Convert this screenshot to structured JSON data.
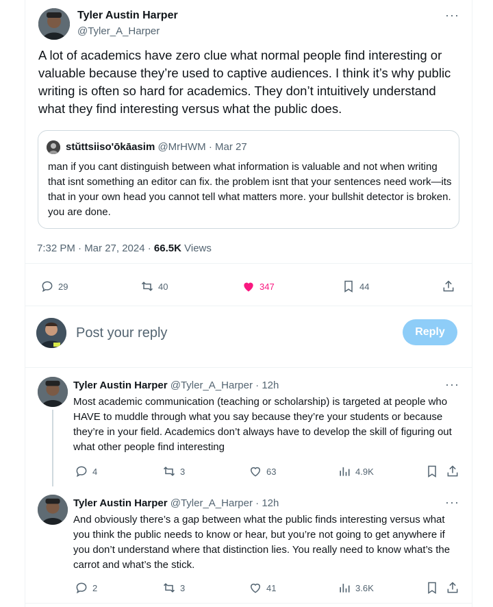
{
  "main_tweet": {
    "author_name": "Tyler Austin Harper",
    "author_handle": "@Tyler_A_Harper",
    "text": "A lot of academics have zero clue what normal people find interesting or valuable because they’re used to captive audiences. I think it’s why public writing is often so hard for academics. They don’t intuitively understand what they find interesting versus what the public does.",
    "quoted": {
      "author_name": "stŭttsiiso'ōkāasim",
      "author_handle": "@MrHWM",
      "date": "· Mar 27",
      "text": "man if you cant distinguish between what information is valuable and not when writing that isnt something an editor can fix. the problem isnt that your sentences need work—its that in your own head you cannot tell what matters more. your bullshit detector is broken. you are done."
    },
    "timestamp": "7:32 PM · Mar 27, 2024 ·",
    "views_count": "66.5K",
    "views_label": "Views",
    "stats": {
      "replies": "29",
      "retweets": "40",
      "likes": "347",
      "bookmarks": "44"
    }
  },
  "reply_box": {
    "placeholder": "Post your reply",
    "button_label": "Reply"
  },
  "replies": [
    {
      "author_name": "Tyler Austin Harper",
      "author_handle": "@Tyler_A_Harper",
      "time": "· 12h",
      "text": "Most academic communication (teaching or scholarship) is targeted at people who HAVE to muddle through what you say because they’re your students or because they’re in your field.  Academics don’t always have to develop the skill of figuring out what other people find interesting",
      "replies": "4",
      "retweets": "3",
      "likes": "63",
      "views": "4.9K"
    },
    {
      "author_name": "Tyler Austin Harper",
      "author_handle": "@Tyler_A_Harper",
      "time": "· 12h",
      "text": "And obviously there’s a gap between what the public finds interesting versus what you think the public needs to know or hear, but you’re not going to get anywhere if you don’t understand where that distinction lies. You really need to know what’s the carrot and what’s the stick.",
      "replies": "2",
      "retweets": "3",
      "likes": "41",
      "views": "3.6K"
    }
  ],
  "colors": {
    "like_active": "#f91880",
    "muted": "#536471",
    "reply_button": "#8ecdf8"
  }
}
